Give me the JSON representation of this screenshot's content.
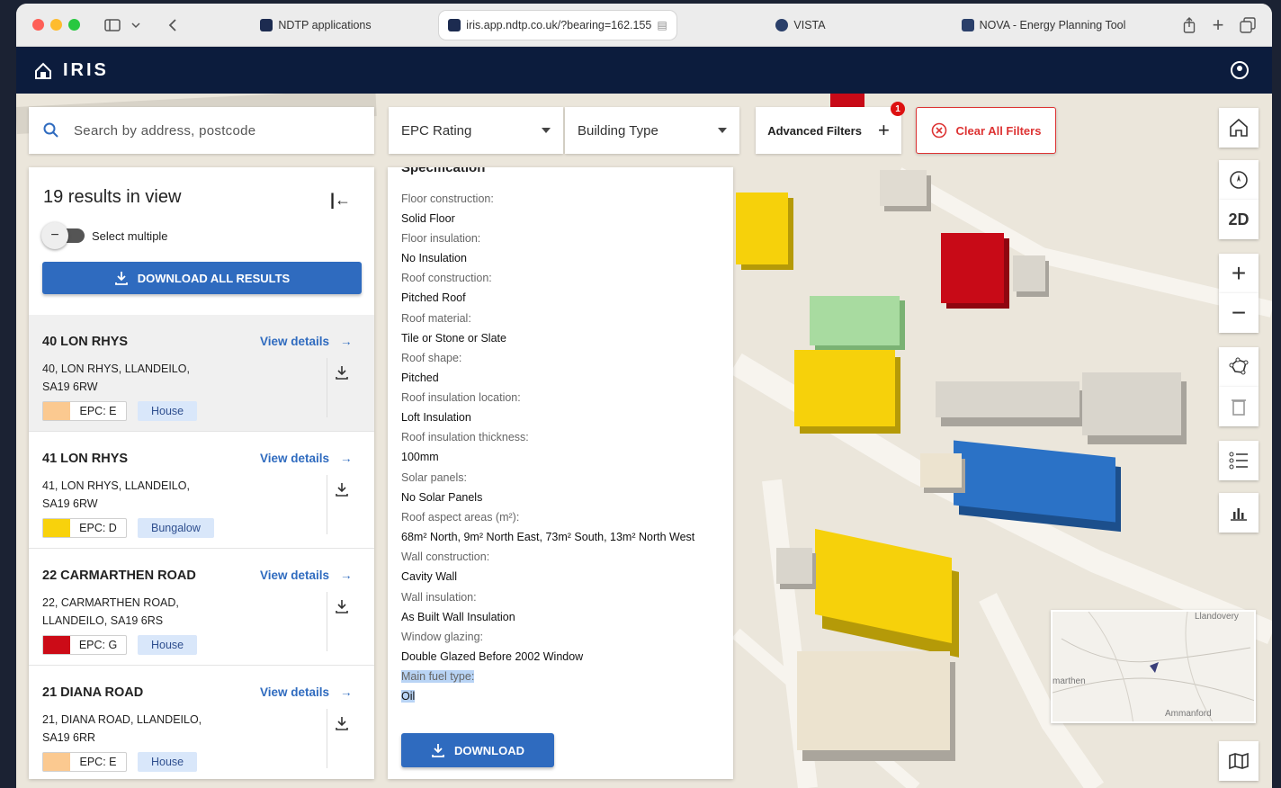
{
  "browser": {
    "tabs": [
      {
        "label": "NDTP applications"
      },
      {
        "label": "iris.app.ndtp.co.uk/?bearing=162.155"
      },
      {
        "label": "VISTA"
      },
      {
        "label": "NOVA - Energy Planning Tool"
      }
    ]
  },
  "app": {
    "title": "IRIS"
  },
  "toolbar": {
    "search_placeholder": "Search by address, postcode",
    "epc_label": "EPC Rating",
    "building_type_label": "Building Type",
    "advanced_filters_label": "Advanced Filters",
    "advanced_filters_count": "1",
    "clear_filters_label": "Clear All Filters"
  },
  "results": {
    "title": "19 results in view",
    "select_multiple_label": "Select multiple",
    "download_all_label": "DOWNLOAD ALL RESULTS",
    "view_details_label": "View details",
    "items": [
      {
        "name": "40 LON RHYS",
        "addr1": "40, LON RHYS, LLANDEILO,",
        "addr2": "SA19 6RW",
        "epc": "EPC: E",
        "epc_color": "#fbc990",
        "type": "House"
      },
      {
        "name": "41 LON RHYS",
        "addr1": "41, LON RHYS, LLANDEILO,",
        "addr2": "SA19 6RW",
        "epc": "EPC: D",
        "epc_color": "#f8d20c",
        "type": "Bungalow"
      },
      {
        "name": "22 CARMARTHEN ROAD",
        "addr1": "22, CARMARTHEN ROAD,",
        "addr2": "LLANDEILO, SA19 6RS",
        "epc": "EPC: G",
        "epc_color": "#cc0b17",
        "type": "House"
      },
      {
        "name": "21 DIANA ROAD",
        "addr1": "21, DIANA ROAD, LLANDEILO,",
        "addr2": "SA19 6RR",
        "epc": "EPC: E",
        "epc_color": "#fbc990",
        "type": "House"
      }
    ]
  },
  "details": {
    "section_title": "Specification",
    "fields": [
      {
        "label": "Floor construction:",
        "value": "Solid Floor"
      },
      {
        "label": "Floor insulation:",
        "value": "No Insulation"
      },
      {
        "label": "Roof construction:",
        "value": "Pitched Roof"
      },
      {
        "label": "Roof material:",
        "value": "Tile or Stone or Slate"
      },
      {
        "label": "Roof shape:",
        "value": "Pitched"
      },
      {
        "label": "Roof insulation location:",
        "value": "Loft Insulation"
      },
      {
        "label": "Roof insulation thickness:",
        "value": "100mm"
      },
      {
        "label": "Solar panels:",
        "value": "No Solar Panels"
      },
      {
        "label": "Roof aspect areas (m²):",
        "value": "68m² North, 9m² North East, 73m² South, 13m² North West"
      },
      {
        "label": "Wall construction:",
        "value": "Cavity Wall"
      },
      {
        "label": "Wall insulation:",
        "value": "As Built Wall Insulation"
      },
      {
        "label": "Window glazing:",
        "value": "Double Glazed Before 2002 Window"
      },
      {
        "label": "Main fuel type:",
        "value": "Oil"
      }
    ],
    "download_label": "DOWNLOAD"
  },
  "map_tools": {
    "view_mode_label": "2D"
  },
  "minimap": {
    "labels": [
      "Llandovery",
      "marthen",
      "Ammanford"
    ]
  }
}
